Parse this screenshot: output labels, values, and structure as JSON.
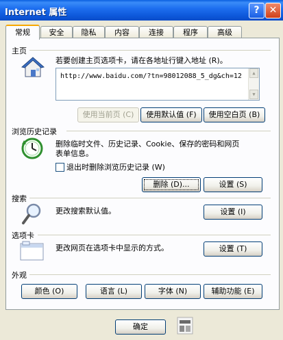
{
  "window": {
    "title": "Internet 属性",
    "help_glyph": "?",
    "close_glyph": "✕"
  },
  "tabs": [
    {
      "label": "常规",
      "active": true
    },
    {
      "label": "安全"
    },
    {
      "label": "隐私"
    },
    {
      "label": "内容"
    },
    {
      "label": "连接"
    },
    {
      "label": "程序"
    },
    {
      "label": "高级"
    }
  ],
  "home": {
    "group_title": "主页",
    "description": "若要创建主页选项卡，请在各地址行键入地址 (R)。",
    "url": "http://www.baidu.com/?tn=98012088_5_dg&ch=12",
    "btn_current": "使用当前页 (C)",
    "btn_default": "使用默认值 (F)",
    "btn_blank": "使用空白页 (B)"
  },
  "history": {
    "group_title": "浏览历史记录",
    "description_line1": "删除临时文件、历史记录、Cookie、保存的密码和网页",
    "description_line2": "表单信息。",
    "checkbox_label": "退出时删除浏览历史记录 (W)",
    "checkbox_checked": false,
    "btn_delete": "删除 (D)...",
    "btn_settings": "设置 (S)"
  },
  "search": {
    "group_title": "搜索",
    "description": "更改搜索默认值。",
    "btn_settings": "设置 (I)"
  },
  "tabs_section": {
    "group_title": "选项卡",
    "description": "更改网页在选项卡中显示的方式。",
    "btn_settings": "设置 (T)"
  },
  "appearance": {
    "group_title": "外观",
    "btn_colors": "颜色 (O)",
    "btn_languages": "语言 (L)",
    "btn_fonts": "字体 (N)",
    "btn_accessibility": "辅助功能 (E)"
  },
  "footer": {
    "btn_ok": "确定"
  },
  "colors": {
    "titlebar": "#0a5fe0",
    "dialog_bg": "#ece9d8",
    "panel_bg": "#fcfcfe",
    "tab_highlight": "#f7a700"
  }
}
